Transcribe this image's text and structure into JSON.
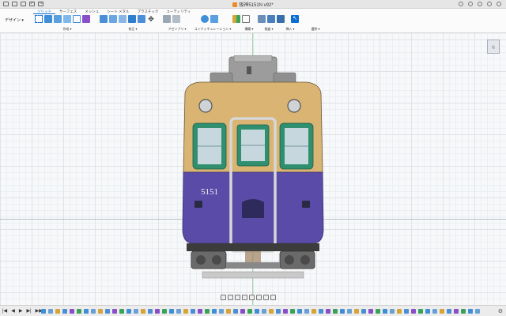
{
  "window": {
    "title": "阪神5151N v92*"
  },
  "ribbon": {
    "workspace_label": "デザイン ▾",
    "tabs": [
      {
        "label": "ソリッド",
        "active": true
      },
      {
        "label": "サーフェス",
        "active": false
      },
      {
        "label": "メッシュ",
        "active": false
      },
      {
        "label": "シート メタル",
        "active": false
      },
      {
        "label": "プラスチック",
        "active": false
      },
      {
        "label": "ユーティリティ",
        "active": false
      }
    ],
    "groups": [
      {
        "label": "作成 ▾"
      },
      {
        "label": "修正 ▾"
      },
      {
        "label": "アセンブリ ▾"
      },
      {
        "label": "コンフィギュレーション ▾"
      },
      {
        "label": "構築 ▾"
      },
      {
        "label": "検査 ▾"
      },
      {
        "label": "挿入 ▾"
      },
      {
        "label": "選択 ▾"
      }
    ]
  },
  "viewcube": {
    "label": "右"
  },
  "model": {
    "car_number": "5151",
    "colors": {
      "upper_body": "#d8b271",
      "lower_body": "#5a4aa8",
      "window_frame": "#2f8f6f",
      "glass": "#c9d8de",
      "roof": "#9a9a9a",
      "underframe": "#4a4a4a"
    }
  },
  "timeline": {
    "controls": [
      "|◀",
      "◀",
      "▶",
      "▶|",
      "▶▶"
    ],
    "settings_icon": "gear-icon"
  },
  "colors": {
    "accent": "#0a6ed1"
  }
}
